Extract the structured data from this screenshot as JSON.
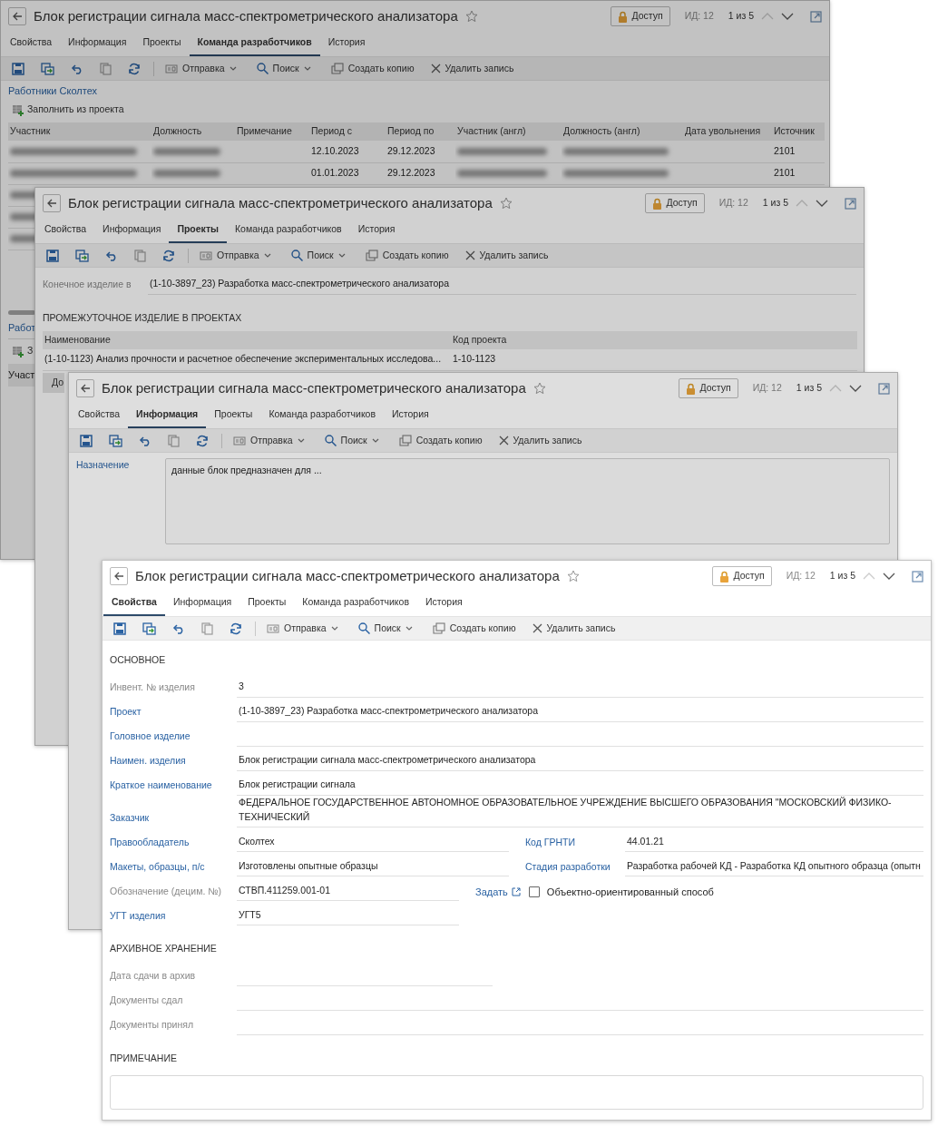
{
  "windows": [
    {
      "title": "Блок регистрации сигнала масс-спектрометрического анализатора",
      "access_button": "Доступ",
      "record_id": "ИД: 12",
      "position": "1 из 5",
      "previous_disabled": true,
      "tabs": [
        {
          "label": "Свойства",
          "selected": false
        },
        {
          "label": "Информация",
          "selected": false
        },
        {
          "label": "Проекты",
          "selected": false
        },
        {
          "label": "Команда разработчиков",
          "selected": true
        },
        {
          "label": "История",
          "selected": false
        }
      ],
      "toolbar": {
        "send": "Отправка",
        "search": "Поиск",
        "copy": "Создать копию",
        "delete": "Удалить запись"
      },
      "view": {
        "kind": "team",
        "group_link": "Работники Сколтех",
        "fill_button": "Заполнить из проекта",
        "columns": [
          "Участник",
          "Должность",
          "Примечание",
          "Период с",
          "Период по",
          "Участник (англ)",
          "Должность (англ)",
          "Дата увольнения",
          "Источник"
        ],
        "rows": [
          {
            "cells": [
              {
                "kind": "redacted"
              },
              {
                "kind": "redacted"
              },
              {
                "kind": "blank"
              },
              {
                "kind": "text",
                "text": "12.10.2023"
              },
              {
                "kind": "text",
                "text": "29.12.2023"
              },
              {
                "kind": "redacted"
              },
              {
                "kind": "redacted"
              },
              {
                "kind": "blank"
              },
              {
                "kind": "text",
                "text": "2101"
              }
            ]
          },
          {
            "cells": [
              {
                "kind": "redacted"
              },
              {
                "kind": "redacted"
              },
              {
                "kind": "blank"
              },
              {
                "kind": "text",
                "text": "01.01.2023"
              },
              {
                "kind": "text",
                "text": "29.12.2023"
              },
              {
                "kind": "redacted"
              },
              {
                "kind": "redacted"
              },
              {
                "kind": "blank"
              },
              {
                "kind": "text",
                "text": "2101"
              }
            ]
          },
          {
            "cells": [
              {
                "kind": "redacted"
              }
            ]
          },
          {
            "cells": [
              {
                "kind": "redacted"
              }
            ]
          },
          {
            "cells": [
              {
                "kind": "redacted"
              }
            ]
          }
        ],
        "lower_section": {
          "group_link": "Работ",
          "fill_button": "З",
          "column": "Участ"
        }
      }
    },
    {
      "title": "Блок регистрации сигнала масс-спектрометрического анализатора",
      "access_button": "Доступ",
      "record_id": "ИД: 12",
      "position": "1 из 5",
      "previous_disabled": true,
      "tabs": [
        {
          "label": "Свойства",
          "selected": false
        },
        {
          "label": "Информация",
          "selected": false
        },
        {
          "label": "Проекты",
          "selected": true
        },
        {
          "label": "Команда разработчиков",
          "selected": false
        },
        {
          "label": "История",
          "selected": false
        }
      ],
      "toolbar": {
        "send": "Отправка",
        "search": "Поиск",
        "copy": "Создать копию",
        "delete": "Удалить запись"
      },
      "view": {
        "kind": "projects",
        "final_label": "Конечное изделие в",
        "final_value": "(1-10-3897_23) Разработка масс-спектрометрического анализатора",
        "section": "ПРОМЕЖУТОЧНОЕ ИЗДЕЛИЕ В ПРОЕКТАХ",
        "columns": [
          "Наименование",
          "Код проекта"
        ],
        "rows": [
          [
            "(1-10-1123) Анализ прочности и расчетное обеспечение экспериментальных исследова...",
            "1-10-1123"
          ]
        ],
        "cut_button": "До"
      }
    },
    {
      "title": "Блок регистрации сигнала масс-спектрометрического анализатора",
      "access_button": "Доступ",
      "record_id": "ИД: 12",
      "position": "1 из 5",
      "previous_disabled": true,
      "tabs": [
        {
          "label": "Свойства",
          "selected": false
        },
        {
          "label": "Информация",
          "selected": true
        },
        {
          "label": "Проекты",
          "selected": false
        },
        {
          "label": "Команда разработчиков",
          "selected": false
        },
        {
          "label": "История",
          "selected": false
        }
      ],
      "toolbar": {
        "send": "Отправка",
        "search": "Поиск",
        "copy": "Создать копию",
        "delete": "Удалить запись"
      },
      "view": {
        "kind": "info",
        "purpose_label": "Назначение",
        "purpose_value": "данные блок предназначен для ..."
      }
    },
    {
      "title": "Блок регистрации сигнала масс-спектрометрического анализатора",
      "access_button": "Доступ",
      "record_id": "ИД: 12",
      "position": "1 из 5",
      "previous_disabled": true,
      "tabs": [
        {
          "label": "Свойства",
          "selected": true
        },
        {
          "label": "Информация",
          "selected": false
        },
        {
          "label": "Проекты",
          "selected": false
        },
        {
          "label": "Команда разработчиков",
          "selected": false
        },
        {
          "label": "История",
          "selected": false
        }
      ],
      "toolbar": {
        "send": "Отправка",
        "search": "Поиск",
        "copy": "Создать копию",
        "delete": "Удалить запись"
      },
      "view": {
        "kind": "properties",
        "items": [
          {
            "kind": "section",
            "title": "ОСНОВНОЕ"
          },
          {
            "kind": "field",
            "label": "Инвент. № изделия",
            "label_link": false,
            "value": "3"
          },
          {
            "kind": "field",
            "label": "Проект",
            "label_link": true,
            "value": "(1-10-3897_23) Разработка масс-спектрометрического анализатора"
          },
          {
            "kind": "field",
            "label": "Головное изделие",
            "label_link": true
          },
          {
            "kind": "field",
            "label": "Наимен. изделия",
            "label_link": true,
            "value": "Блок регистрации сигнала масс-спектрометрического анализатора"
          },
          {
            "kind": "field",
            "label": "Краткое наименование",
            "label_link": true,
            "value": "Блок регистрации сигнала"
          },
          {
            "kind": "field",
            "label": "Заказчик",
            "label_link": true,
            "value": "ФЕДЕРАЛЬНОЕ ГОСУДАРСТВЕННОЕ АВТОНОМНОЕ ОБРАЗОВАТЕЛЬНОЕ УЧРЕЖДЕНИЕ ВЫСШЕГО ОБРАЗОВАНИЯ \"МОСКОВСКИЙ ФИЗИКО-ТЕХНИЧЕСКИЙ"
          },
          {
            "kind": "pair",
            "left": {
              "label": "Правообладатель",
              "label_link": true,
              "value": "Сколтех"
            },
            "right": {
              "label": "Код ГРНТИ",
              "label_link": true,
              "value": "44.01.21"
            }
          },
          {
            "kind": "pair",
            "left": {
              "label": "Макеты, образцы, п/с",
              "label_link": true,
              "value": "Изготовлены опытные образцы"
            },
            "right": {
              "label": "Стадия разработки",
              "label_link": true,
              "value": "Разработка рабочей КД - Разработка КД опытного образца (опытн"
            }
          },
          {
            "kind": "designation",
            "label": "Обозначение (децим. №)",
            "label_link": false,
            "value": "СТВП.411259.001-01",
            "action_link": "Задать",
            "checkbox": {
              "label": "Объектно-ориентированный способ",
              "checked": false
            }
          },
          {
            "kind": "short_field",
            "label": "УГТ изделия",
            "label_link": true,
            "value": "УГТ5"
          },
          {
            "kind": "section",
            "title": "АРХИВНОЕ ХРАНЕНИЕ"
          },
          {
            "kind": "date_field",
            "label": "Дата сдачи в архив",
            "label_link": false
          },
          {
            "kind": "field",
            "label": "Документы сдал",
            "label_link": false
          },
          {
            "kind": "field",
            "label": "Документы принял",
            "label_link": false
          },
          {
            "kind": "note",
            "title": "ПРИМЕЧАНИЕ"
          }
        ]
      }
    }
  ]
}
